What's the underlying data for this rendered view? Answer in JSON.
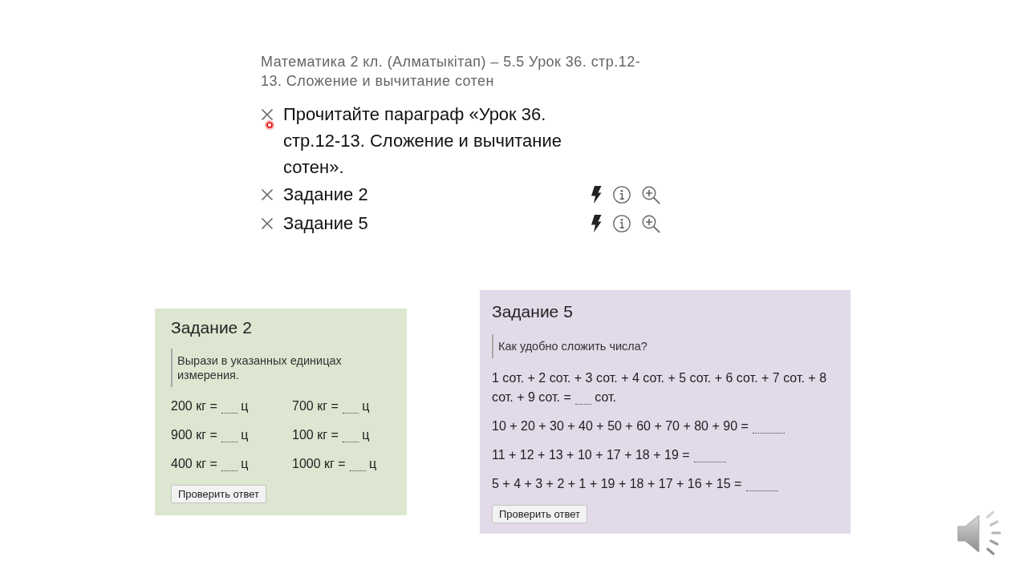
{
  "lesson": {
    "title": "Математика 2 кл. (Алматыкітап) – 5.5 Урок 36. стр.12-13. Сложение и вычитание сотен",
    "items": [
      {
        "kind": "reading",
        "label": "Прочитайте параграф «Урок 36. стр.12-13. Сложение и вычитание сотен»."
      },
      {
        "kind": "task",
        "label": "Задание 2"
      },
      {
        "kind": "task",
        "label": "Задание 5"
      }
    ]
  },
  "task_cards": [
    {
      "title": "Задание 2",
      "prompt": "Вырази в указанных единицах измерения.",
      "color": "#dce6d0",
      "rows": [
        [
          {
            "before": "200 кг =",
            "after": "ц"
          },
          {
            "before": "700 кг =",
            "after": "ц"
          }
        ],
        [
          {
            "before": "900 кг =",
            "after": "ц"
          },
          {
            "before": "100 кг =",
            "after": "ц"
          }
        ],
        [
          {
            "before": "400 кг =",
            "after": "ц"
          },
          {
            "before": "1000 кг =",
            "after": "ц"
          }
        ]
      ],
      "button": "Проверить ответ"
    },
    {
      "title": "Задание 5",
      "prompt": "Как удобно сложить числа?",
      "color": "#e2d9e9",
      "rows": [
        [
          {
            "before": "1 сот. + 2 сот. + 3 сот. + 4 сот. + 5 сот. + 6 сот. + 7 сот. + 8 сот. + 9 сот. =",
            "after": "сот."
          }
        ],
        [
          {
            "before": "10 + 20 + 30 + 40 + 50 + 60 + 70 + 80 + 90 ="
          }
        ],
        [
          {
            "before": "11 + 12 + 13 + 10 + 17 + 18 + 19 ="
          }
        ],
        [
          {
            "before": "5 + 4 + 3 + 2 + 1 + 19 + 18 + 17 + 16 + 15 ="
          }
        ]
      ],
      "button": "Проверить ответ"
    }
  ]
}
